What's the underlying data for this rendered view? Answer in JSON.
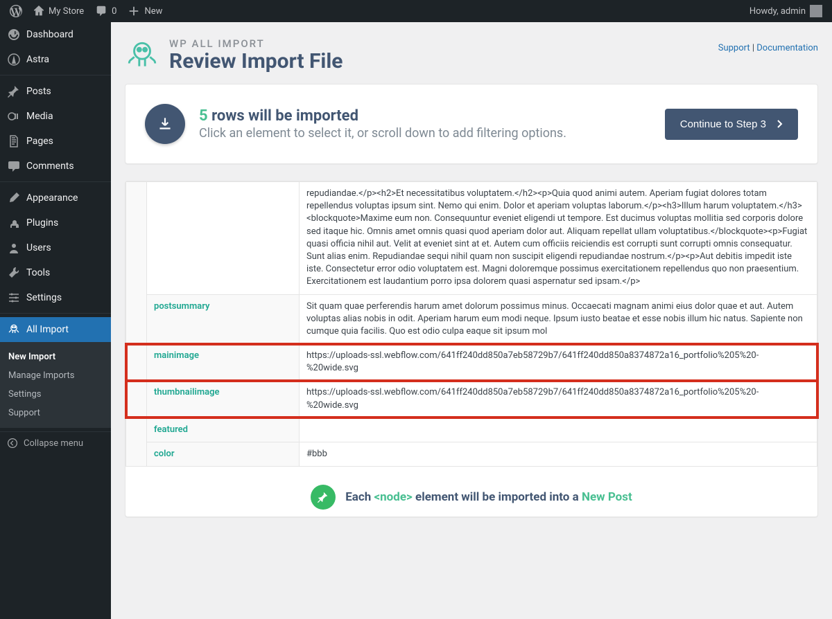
{
  "topbar": {
    "site_name": "My Store",
    "comments_count": "0",
    "new_label": "New",
    "howdy": "Howdy, admin"
  },
  "sidebar": {
    "dashboard": "Dashboard",
    "astra": "Astra",
    "posts": "Posts",
    "media": "Media",
    "pages": "Pages",
    "comments": "Comments",
    "appearance": "Appearance",
    "plugins": "Plugins",
    "users": "Users",
    "tools": "Tools",
    "settings": "Settings",
    "all_import": "All Import",
    "submenu": {
      "new_import": "New Import",
      "manage_imports": "Manage Imports",
      "settings": "Settings",
      "support": "Support"
    },
    "collapse": "Collapse menu"
  },
  "header": {
    "brand": "WP ALL IMPORT",
    "title": "Review Import File",
    "support": "Support",
    "documentation": "Documentation"
  },
  "intro": {
    "count": "5",
    "rows_label": " rows will be imported",
    "subtitle": "Click an element to select it, or scroll down to add filtering options.",
    "continue": "Continue to Step 3"
  },
  "table": {
    "bigtext": "repudiandae.</p><h2>Et necessitatibus voluptatem.</h2><p>Quia quod animi autem. Aperiam fugiat dolores totam repellendus voluptas ipsum sint. Nemo qui enim. Dolor et aperiam voluptas laborum.</p><h3>Illum harum voluptatem.</h3><blockquote>Maxime eum non. Consequuntur eveniet eligendi ut tempore. Est ducimus voluptas mollitia sed corporis dolore sed itaque hic. Omnis amet omnis quasi quod aperiam dolor aut. Aliquam repellat ullam voluptatibus.</blockquote><p>Fugiat quasi officia nihil aut. Velit at eveniet sint at et. Autem cum officiis reiciendis est corrupti sunt corrupti omnis consequatur. Sunt alias enim. Repudiandae sequi nihil quam non suscipit eligendi repudiandae nostrum.</p><p>Aut debitis impedit iste iste. Consectetur error odio voluptatem est. Magni doloremque possimus exercitationem repellendus quo non praesentium. Exercitationem est laudantium porro ipsa dolorem quasi aspernatur sed ipsam.</p>",
    "postsummary_key": "postsummary",
    "postsummary_val": "Sit quam quae perferendis harum amet dolorum possimus minus. Occaecati magnam animi eius dolor quae et aut. Autem voluptas alias nobis in odit. Aperiam harum eum modi neque. Ipsum iusto beatae et esse nobis illum hic natus. Sapiente non cumque quia facilis. Quo est odio culpa eaque sit ipsum mol",
    "mainimage_key": "mainimage",
    "mainimage_val": "https://uploads-ssl.webflow.com/641ff240dd850a7eb58729b7/641ff240dd850a8374872a16_portfolio%205%20-%20wide.svg",
    "thumbnailimage_key": "thumbnailimage",
    "thumbnailimage_val": "https://uploads-ssl.webflow.com/641ff240dd850a7eb58729b7/641ff240dd850a8374872a16_portfolio%205%20-%20wide.svg",
    "featured_key": "featured",
    "featured_val": "",
    "color_key": "color",
    "color_val": "#bbb"
  },
  "footer": {
    "each": "Each ",
    "node": "<node>",
    "middle": " element will be imported into a ",
    "new_post": "New Post"
  }
}
